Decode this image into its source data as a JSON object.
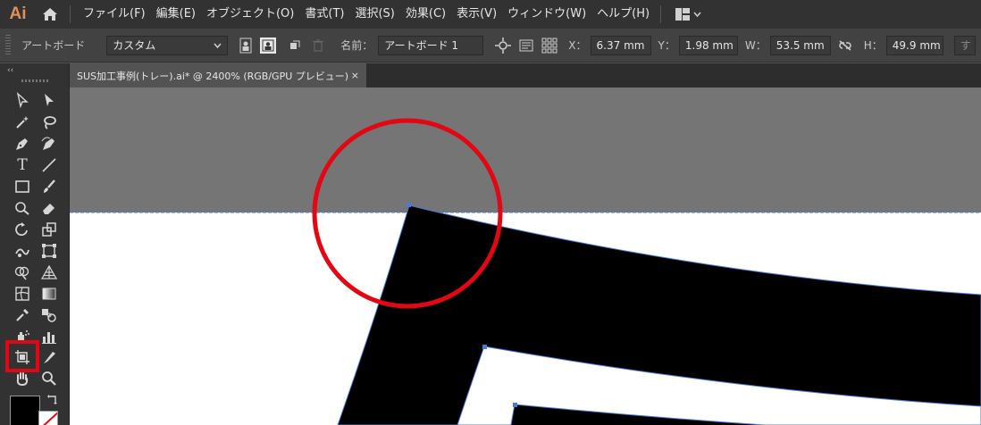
{
  "app": {
    "logo": "Ai"
  },
  "menu": {
    "items": [
      {
        "label": "ファイル(F)",
        "name": "menu-file"
      },
      {
        "label": "編集(E)",
        "name": "menu-edit"
      },
      {
        "label": "オブジェクト(O)",
        "name": "menu-object"
      },
      {
        "label": "書式(T)",
        "name": "menu-type"
      },
      {
        "label": "選択(S)",
        "name": "menu-select"
      },
      {
        "label": "効果(C)",
        "name": "menu-effect"
      },
      {
        "label": "表示(V)",
        "name": "menu-view"
      },
      {
        "label": "ウィンドウ(W)",
        "name": "menu-window"
      },
      {
        "label": "ヘルプ(H)",
        "name": "menu-help"
      }
    ]
  },
  "control": {
    "artboard_label": "アートボード",
    "preset_value": "カスタム",
    "name_label": "名前：",
    "name_value": "アートボード 1",
    "x_label": "X：",
    "x_value": "6.37 mm",
    "y_label": "Y：",
    "y_value": "1.98 mm",
    "w_label": "W：",
    "w_value": "53.5 mm",
    "h_label": "H：",
    "h_value": "49.9 mm",
    "overflow_text": "す"
  },
  "document": {
    "tab_title": "SUS加工事例(トレー).ai* @ 2400% (RGB/GPU プレビュー)",
    "close_glyph": "×"
  },
  "toolbar": {
    "collapse_glyph": "‹‹",
    "type_glyph": "T"
  },
  "colors": {
    "accent_highlight": "#e30613",
    "selection_blue": "#4a7bd8",
    "pasteboard": "#757575",
    "artboard": "#ffffff",
    "shape_fill": "#000000"
  }
}
